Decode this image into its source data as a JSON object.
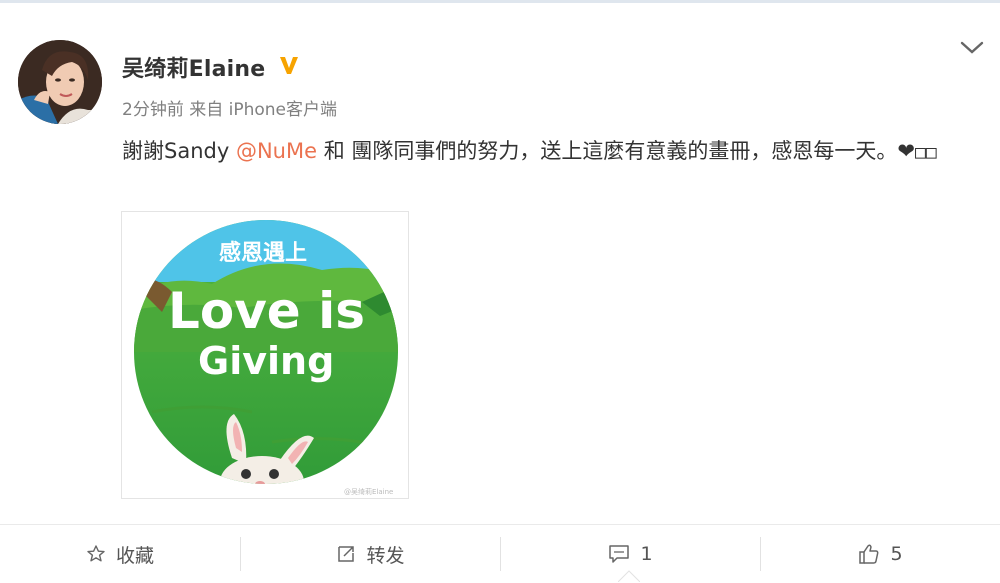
{
  "post": {
    "username": "吴绮莉Elaine",
    "verified_badge": "V",
    "meta": "2分钟前 来自 iPhone客户端",
    "content": {
      "part1": "謝謝Sandy ",
      "mention": "@NuMe",
      "part2": " 和 團隊同事們的努力，送上這麼有意義的畫冊，感恩每一天。❤",
      "boxes": "□□"
    },
    "image": {
      "title_chinese": "感恩遇上",
      "line1": "Love is",
      "line2": "Giving",
      "watermark": "@吴绮莉Elaine"
    }
  },
  "actions": {
    "favorite_label": "收藏",
    "repost_label": "转发",
    "comment_count": "1",
    "like_count": "5"
  },
  "colors": {
    "mention": "#eb7350",
    "verified": "#f7a300",
    "grass": "#3fa83a",
    "sky": "#4fc4e8"
  }
}
